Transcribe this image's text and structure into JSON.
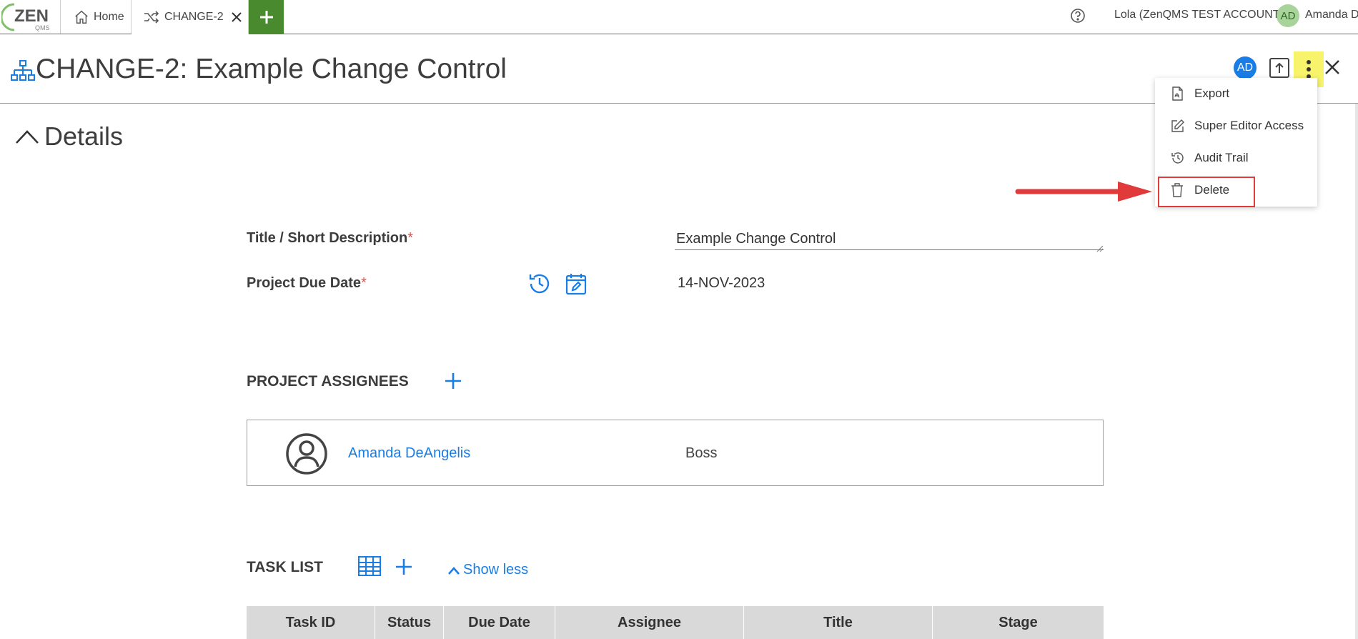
{
  "app": {
    "logo_text": "ZEN",
    "logo_sub": "QMS",
    "tabs": [
      {
        "label": "Home",
        "icon": "home-icon"
      },
      {
        "label": "CHANGE-2",
        "icon": "shuffle-icon"
      }
    ],
    "account_label": "Lola (ZenQMS TEST ACCOUNT)",
    "user_initials": "AD",
    "user_name": "Amanda D"
  },
  "header": {
    "title": "CHANGE-2: Example Change Control",
    "avatar_initials": "AD"
  },
  "menu": {
    "items": [
      {
        "label": "Export",
        "icon": "pdf-file-icon"
      },
      {
        "label": "Super Editor Access",
        "icon": "edit-icon"
      },
      {
        "label": "Audit Trail",
        "icon": "history-icon"
      },
      {
        "label": "Delete",
        "icon": "trash-icon"
      }
    ]
  },
  "details": {
    "section_label": "Details",
    "title_label": "Title / Short Description",
    "title_value": "Example Change Control",
    "due_label": "Project Due Date",
    "due_value": "14-NOV-2023",
    "required_mark": "*"
  },
  "assignees": {
    "heading": "PROJECT ASSIGNEES",
    "items": [
      {
        "name": "Amanda DeAngelis",
        "role": "Boss"
      }
    ]
  },
  "tasks": {
    "heading": "TASK LIST",
    "show_less": "Show less",
    "columns": [
      "Task ID",
      "Status",
      "Due Date",
      "Assignee",
      "Title",
      "Stage"
    ]
  },
  "colors": {
    "accent": "#1a7de6",
    "brand_green": "#4a8a2e",
    "highlight": "#f7f36a",
    "annotation_red": "#e03a3a"
  }
}
